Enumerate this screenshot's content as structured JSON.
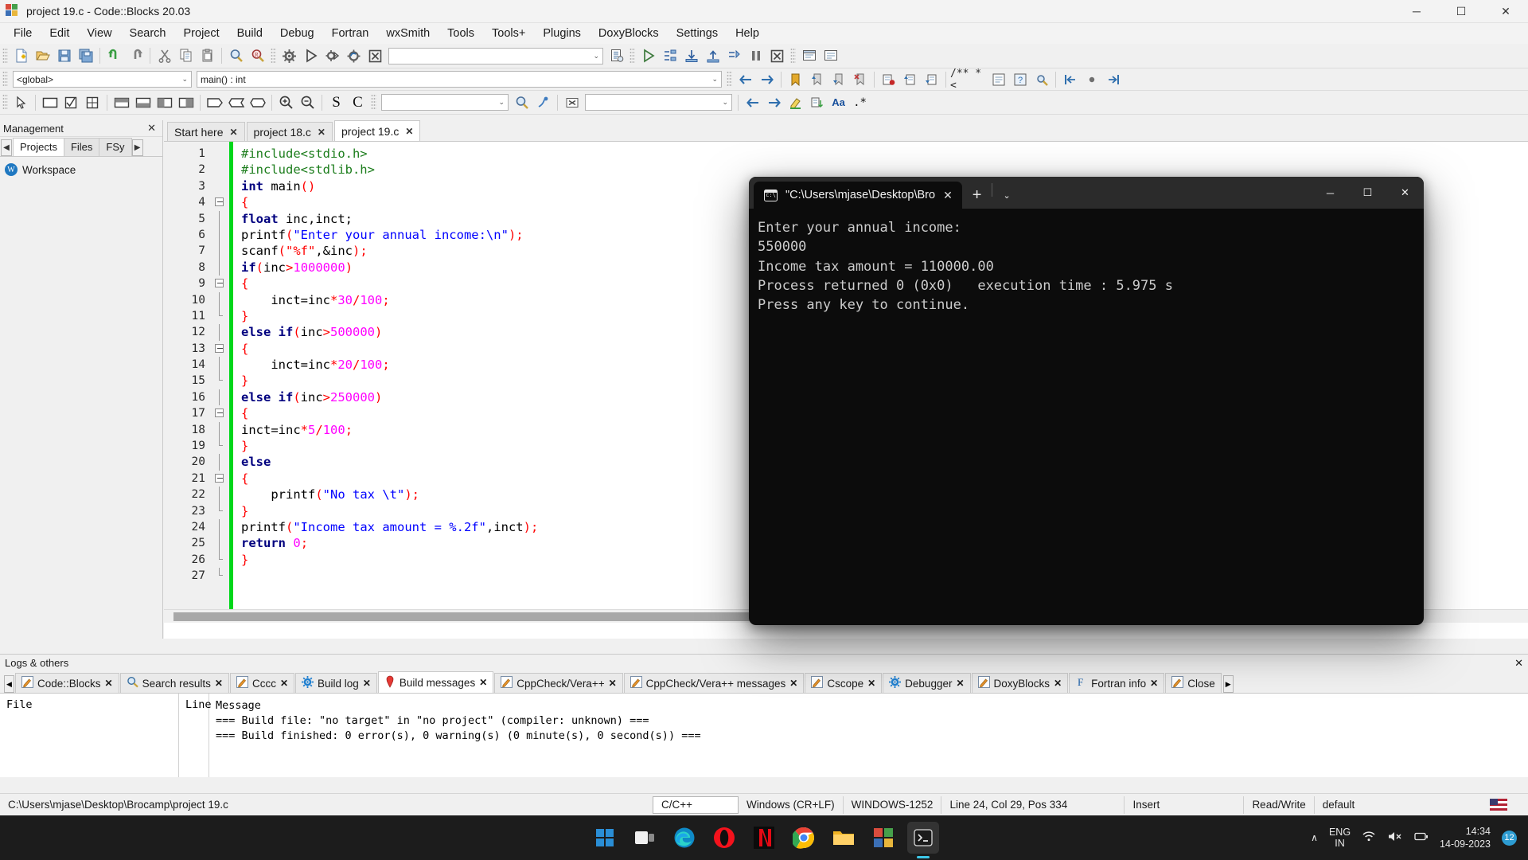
{
  "window": {
    "title": "project 19.c - Code::Blocks 20.03",
    "minimize": "─",
    "maximize": "☐",
    "close": "✕"
  },
  "menubar": {
    "items": [
      "File",
      "Edit",
      "View",
      "Search",
      "Project",
      "Build",
      "Debug",
      "Fortran",
      "wxSmith",
      "Tools",
      "Tools+",
      "Plugins",
      "DoxyBlocks",
      "Settings",
      "Help"
    ]
  },
  "toolbar_row1": {
    "combo_value": "",
    "combo_arrow": "⌄"
  },
  "toolbar_row2": {
    "scope_combo": "<global>",
    "function_combo": "main() : int",
    "combo_arrow": "⌄",
    "doxy_label": "/** *<"
  },
  "toolbar_row3": {
    "combo1": "",
    "combo2": "",
    "letter_s": "S",
    "letter_c": "C",
    "aa_label": "Aa",
    "star_label": ".*"
  },
  "management": {
    "header": "Management",
    "close": "✕",
    "nav_left": "◀",
    "nav_right": "▶",
    "tabs": [
      "Projects",
      "Files",
      "FSy"
    ],
    "active_tab": "Projects",
    "tree_root": "Workspace",
    "tree_icon": "W"
  },
  "editor": {
    "tabs": [
      {
        "label": "Start here",
        "close": "✕",
        "active": false
      },
      {
        "label": "project 18.c",
        "close": "✕",
        "active": false
      },
      {
        "label": "project 19.c",
        "close": "✕",
        "active": true
      }
    ],
    "line_numbers": [
      "1",
      "2",
      "3",
      "4",
      "5",
      "6",
      "7",
      "8",
      "9",
      "10",
      "11",
      "12",
      "13",
      "14",
      "15",
      "16",
      "17",
      "18",
      "19",
      "20",
      "21",
      "22",
      "23",
      "24",
      "25",
      "26",
      "27"
    ],
    "code_lines": [
      [
        {
          "t": "#include<stdio.h>",
          "c": "cm"
        }
      ],
      [
        {
          "t": "#include<stdlib.h>",
          "c": "cm"
        }
      ],
      [
        {
          "t": "int",
          "c": "k"
        },
        {
          "t": " main",
          "c": "id"
        },
        {
          "t": "()",
          "c": "op"
        }
      ],
      [
        {
          "t": "{",
          "c": "op"
        }
      ],
      [
        {
          "t": "float",
          "c": "k"
        },
        {
          "t": " inc,inct;",
          "c": "id"
        }
      ],
      [
        {
          "t": "printf",
          "c": "id"
        },
        {
          "t": "(",
          "c": "op"
        },
        {
          "t": "\"Enter your annual income:\\n\"",
          "c": "sb"
        },
        {
          "t": ");",
          "c": "op"
        }
      ],
      [
        {
          "t": "scanf",
          "c": "id"
        },
        {
          "t": "(",
          "c": "op"
        },
        {
          "t": "\"%f\"",
          "c": "st"
        },
        {
          "t": ",&inc",
          "c": "id"
        },
        {
          "t": ");",
          "c": "op"
        }
      ],
      [
        {
          "t": "if",
          "c": "k"
        },
        {
          "t": "(",
          "c": "op"
        },
        {
          "t": "inc",
          "c": "id"
        },
        {
          "t": ">",
          "c": "op"
        },
        {
          "t": "1000000",
          "c": "nu"
        },
        {
          "t": ")",
          "c": "op"
        }
      ],
      [
        {
          "t": "{",
          "c": "op"
        }
      ],
      [
        {
          "t": "    inct=inc",
          "c": "id"
        },
        {
          "t": "*",
          "c": "op"
        },
        {
          "t": "30",
          "c": "nu"
        },
        {
          "t": "/",
          "c": "op"
        },
        {
          "t": "100",
          "c": "nu"
        },
        {
          "t": ";",
          "c": "op"
        }
      ],
      [
        {
          "t": "}",
          "c": "op"
        }
      ],
      [
        {
          "t": "else if",
          "c": "k"
        },
        {
          "t": "(",
          "c": "op"
        },
        {
          "t": "inc",
          "c": "id"
        },
        {
          "t": ">",
          "c": "op"
        },
        {
          "t": "500000",
          "c": "nu"
        },
        {
          "t": ")",
          "c": "op"
        }
      ],
      [
        {
          "t": "{",
          "c": "op"
        }
      ],
      [
        {
          "t": "    inct=inc",
          "c": "id"
        },
        {
          "t": "*",
          "c": "op"
        },
        {
          "t": "20",
          "c": "nu"
        },
        {
          "t": "/",
          "c": "op"
        },
        {
          "t": "100",
          "c": "nu"
        },
        {
          "t": ";",
          "c": "op"
        }
      ],
      [
        {
          "t": "}",
          "c": "op"
        }
      ],
      [
        {
          "t": "else if",
          "c": "k"
        },
        {
          "t": "(",
          "c": "op"
        },
        {
          "t": "inc",
          "c": "id"
        },
        {
          "t": ">",
          "c": "op"
        },
        {
          "t": "250000",
          "c": "nu"
        },
        {
          "t": ")",
          "c": "op"
        }
      ],
      [
        {
          "t": "{",
          "c": "op"
        }
      ],
      [
        {
          "t": "inct=inc",
          "c": "id"
        },
        {
          "t": "*",
          "c": "op"
        },
        {
          "t": "5",
          "c": "nu"
        },
        {
          "t": "/",
          "c": "op"
        },
        {
          "t": "100",
          "c": "nu"
        },
        {
          "t": ";",
          "c": "op"
        }
      ],
      [
        {
          "t": "}",
          "c": "op"
        }
      ],
      [
        {
          "t": "else",
          "c": "k"
        }
      ],
      [
        {
          "t": "{",
          "c": "op"
        }
      ],
      [
        {
          "t": "    printf",
          "c": "id"
        },
        {
          "t": "(",
          "c": "op"
        },
        {
          "t": "\"No tax \\t\"",
          "c": "sb"
        },
        {
          "t": ");",
          "c": "op"
        }
      ],
      [
        {
          "t": "}",
          "c": "op"
        }
      ],
      [
        {
          "t": "printf",
          "c": "id"
        },
        {
          "t": "(",
          "c": "op"
        },
        {
          "t": "\"Income tax amount = %.2f\"",
          "c": "sb"
        },
        {
          "t": ",inct",
          "c": "id"
        },
        {
          "t": ");",
          "c": "op"
        }
      ],
      [
        {
          "t": "return",
          "c": "k"
        },
        {
          "t": " ",
          "c": "id"
        },
        {
          "t": "0",
          "c": "nu"
        },
        {
          "t": ";",
          "c": "op"
        }
      ],
      [
        {
          "t": "}",
          "c": "op"
        }
      ],
      []
    ]
  },
  "console": {
    "tab_title": "\"C:\\Users\\mjase\\Desktop\\Bro",
    "tab_close": "✕",
    "new_tab": "+",
    "dropdown": "⌄",
    "minimize": "─",
    "maximize": "☐",
    "close": "✕",
    "output": [
      "Enter your annual income:",
      "550000",
      "Income tax amount = 110000.00",
      "Process returned 0 (0x0)   execution time : 5.975 s",
      "Press any key to continue."
    ]
  },
  "logs": {
    "header": "Logs & others",
    "close": "✕",
    "nav_left": "◀",
    "nav_right": "▶",
    "tabs": [
      {
        "label": "Code::Blocks",
        "icon": "pencil-icon",
        "active": false
      },
      {
        "label": "Search results",
        "icon": "magnifier-icon",
        "active": false
      },
      {
        "label": "Cccc",
        "icon": "pencil-icon",
        "active": false
      },
      {
        "label": "Build log",
        "icon": "gear-icon",
        "active": false
      },
      {
        "label": "Build messages",
        "icon": "pin-icon",
        "active": true
      },
      {
        "label": "CppCheck/Vera++",
        "icon": "pencil-icon",
        "active": false
      },
      {
        "label": "CppCheck/Vera++ messages",
        "icon": "pencil-icon",
        "active": false
      },
      {
        "label": "Cscope",
        "icon": "pencil-icon",
        "active": false
      },
      {
        "label": "Debugger",
        "icon": "gear-icon",
        "active": false
      },
      {
        "label": "DoxyBlocks",
        "icon": "pencil-icon",
        "active": false
      },
      {
        "label": "Fortran info",
        "icon": "f-icon",
        "active": false
      },
      {
        "label": "Close",
        "icon": "pencil-icon",
        "active": false
      }
    ],
    "columns": {
      "file": "File",
      "line": "Line",
      "message": "Message"
    },
    "messages": [
      "=== Build file: \"no target\" in \"no project\" (compiler: unknown) ===",
      "=== Build finished: 0 error(s), 0 warning(s) (0 minute(s), 0 second(s)) ==="
    ]
  },
  "statusbar": {
    "path": "C:\\Users\\mjase\\Desktop\\Brocamp\\project 19.c",
    "language": "C/C++",
    "eol": "Windows (CR+LF)",
    "encoding": "WINDOWS-1252",
    "caret": "Line 24, Col 29, Pos 334",
    "insert_mode": "Insert",
    "access": "Read/Write",
    "profile": "default"
  },
  "taskbar": {
    "items": [
      {
        "name": "start-button",
        "label": "Start"
      },
      {
        "name": "task-view-button",
        "label": "Task View"
      },
      {
        "name": "edge-icon",
        "label": "Microsoft Edge"
      },
      {
        "name": "opera-icon",
        "label": "Opera"
      },
      {
        "name": "netflix-icon",
        "label": "Netflix"
      },
      {
        "name": "chrome-icon",
        "label": "Google Chrome"
      },
      {
        "name": "file-explorer-icon",
        "label": "File Explorer"
      },
      {
        "name": "codeblocks-icon",
        "label": "Code::Blocks"
      },
      {
        "name": "terminal-icon",
        "label": "Terminal"
      }
    ],
    "chevron": "∧",
    "lang_line1": "ENG",
    "lang_line2": "IN",
    "time": "14:34",
    "date": "14-09-2023",
    "badge": "12"
  }
}
